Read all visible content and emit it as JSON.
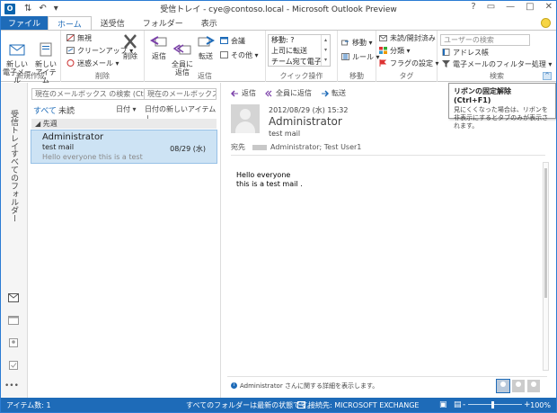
{
  "window": {
    "app_icon": "O",
    "title": "受信トレイ - cye@contoso.local - Microsoft Outlook Preview",
    "controls": [
      "?",
      "▭",
      "—",
      "□",
      "✕"
    ]
  },
  "tabs": [
    "ファイル",
    "ホーム",
    "送受信",
    "フォルダー",
    "表示"
  ],
  "ribbon": {
    "new_group": {
      "label": "新規作成",
      "new_email": "新しい\n電子メール",
      "new_items": "新しい\nアイテム"
    },
    "delete_group": {
      "label": "削除",
      "ignore": "無視",
      "cleanup": "クリーンアップ",
      "junk": "迷惑メール",
      "delete": "削除"
    },
    "respond_group": {
      "label": "返信",
      "reply": "返信",
      "reply_all": "全員に\n返信",
      "forward": "転送",
      "meeting": "会議",
      "more": "その他"
    },
    "quicksteps_group": {
      "label": "クイック操作",
      "items": [
        "移動: ?",
        "上司に転送",
        "チーム宛て電子..."
      ]
    },
    "move_group": {
      "label": "移動",
      "move": "移動",
      "rules": "ルール"
    },
    "tags_group": {
      "label": "タグ",
      "unread_read": "未読/開封済み",
      "categorize": "分類",
      "followup": "フラグの設定"
    },
    "find_group": {
      "label": "検索",
      "search_people_placeholder": "ユーザーの検索",
      "address_book": "アドレス帳",
      "filter_email": "電子メールのフィルター処理"
    }
  },
  "tooltip": {
    "title": "リボンの固定解除 (Ctrl+F1)",
    "body": "見にくくなった場合は、リボンを非表示にするとタブのみが表示されます。"
  },
  "leftnav": {
    "inbox_label": "受信トレイ",
    "all_folders_label": "すべてのフォルダー",
    "more": "•••"
  },
  "msglist": {
    "search_placeholder": "現在のメールボックス の検索 (Ctrl...",
    "search_scope": "現在のメールボックス",
    "filter_all": "すべて",
    "filter_unread": "未読",
    "sort_by": "日付 ▾",
    "sort_order": "日付の新しいアイテム ↓",
    "group_header": "◢ 先週",
    "items": [
      {
        "from": "Administrator",
        "subject": "test mail",
        "preview": "Hello everyone   this is a test",
        "date": "08/29 (水)"
      }
    ]
  },
  "reading": {
    "reply": "返信",
    "reply_all": "全員に返信",
    "forward": "転送",
    "date": "2012/08/29 (水) 15:32",
    "from": "Administrator",
    "subject": "test mail",
    "to_label": "宛先",
    "to_recipients": "Administrator; Test User1",
    "body_line1": "Hello everyone",
    "body_line2": "this is a test mail .",
    "info_text": "Administrator さんに関する詳細を表示します。"
  },
  "statusbar": {
    "item_count": "アイテム数: 1",
    "status": "すべてのフォルダーは最新の状態です。",
    "connection": "接続先: MICROSOFT EXCHANGE",
    "zoom": "100%"
  },
  "colors": {
    "accent": "#1e6bb8",
    "selected_item": "#cde3f4"
  }
}
